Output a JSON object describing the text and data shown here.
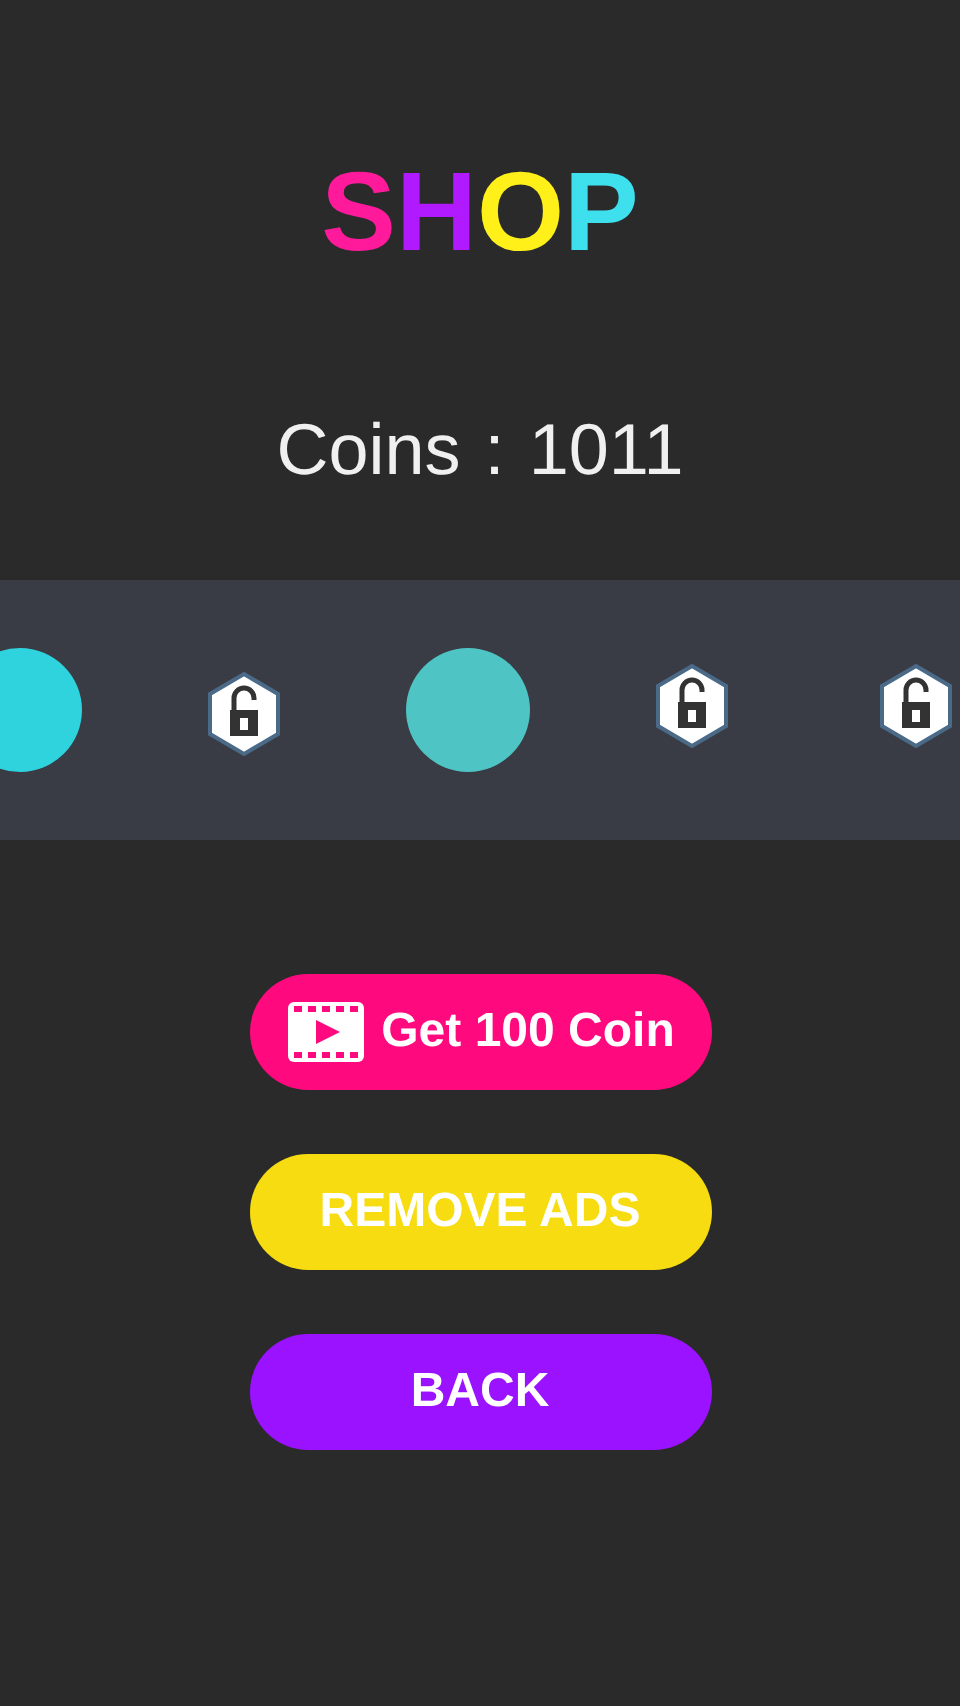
{
  "title": {
    "letters": [
      {
        "text": "S",
        "color": "#ff1a9c"
      },
      {
        "text": "H",
        "color": "#b11aff"
      },
      {
        "text": "O",
        "color": "#fff01a"
      },
      {
        "text": "P",
        "color": "#3fe0ee"
      }
    ]
  },
  "coins": {
    "label": "Coins",
    "separator": ":",
    "value": "1011"
  },
  "items": [
    {
      "kind": "ball",
      "color": "#2fd3de"
    },
    {
      "kind": "locked"
    },
    {
      "kind": "ball",
      "color": "#4ec4c4"
    },
    {
      "kind": "locked"
    },
    {
      "kind": "locked"
    }
  ],
  "buttons": [
    {
      "label": "Get 100 Coin",
      "color": "#ff0a7e",
      "kind": "video"
    },
    {
      "label": "REMOVE ADS",
      "color": "#f6dc10"
    },
    {
      "label": "BACK",
      "color": "#9a12ff"
    }
  ]
}
